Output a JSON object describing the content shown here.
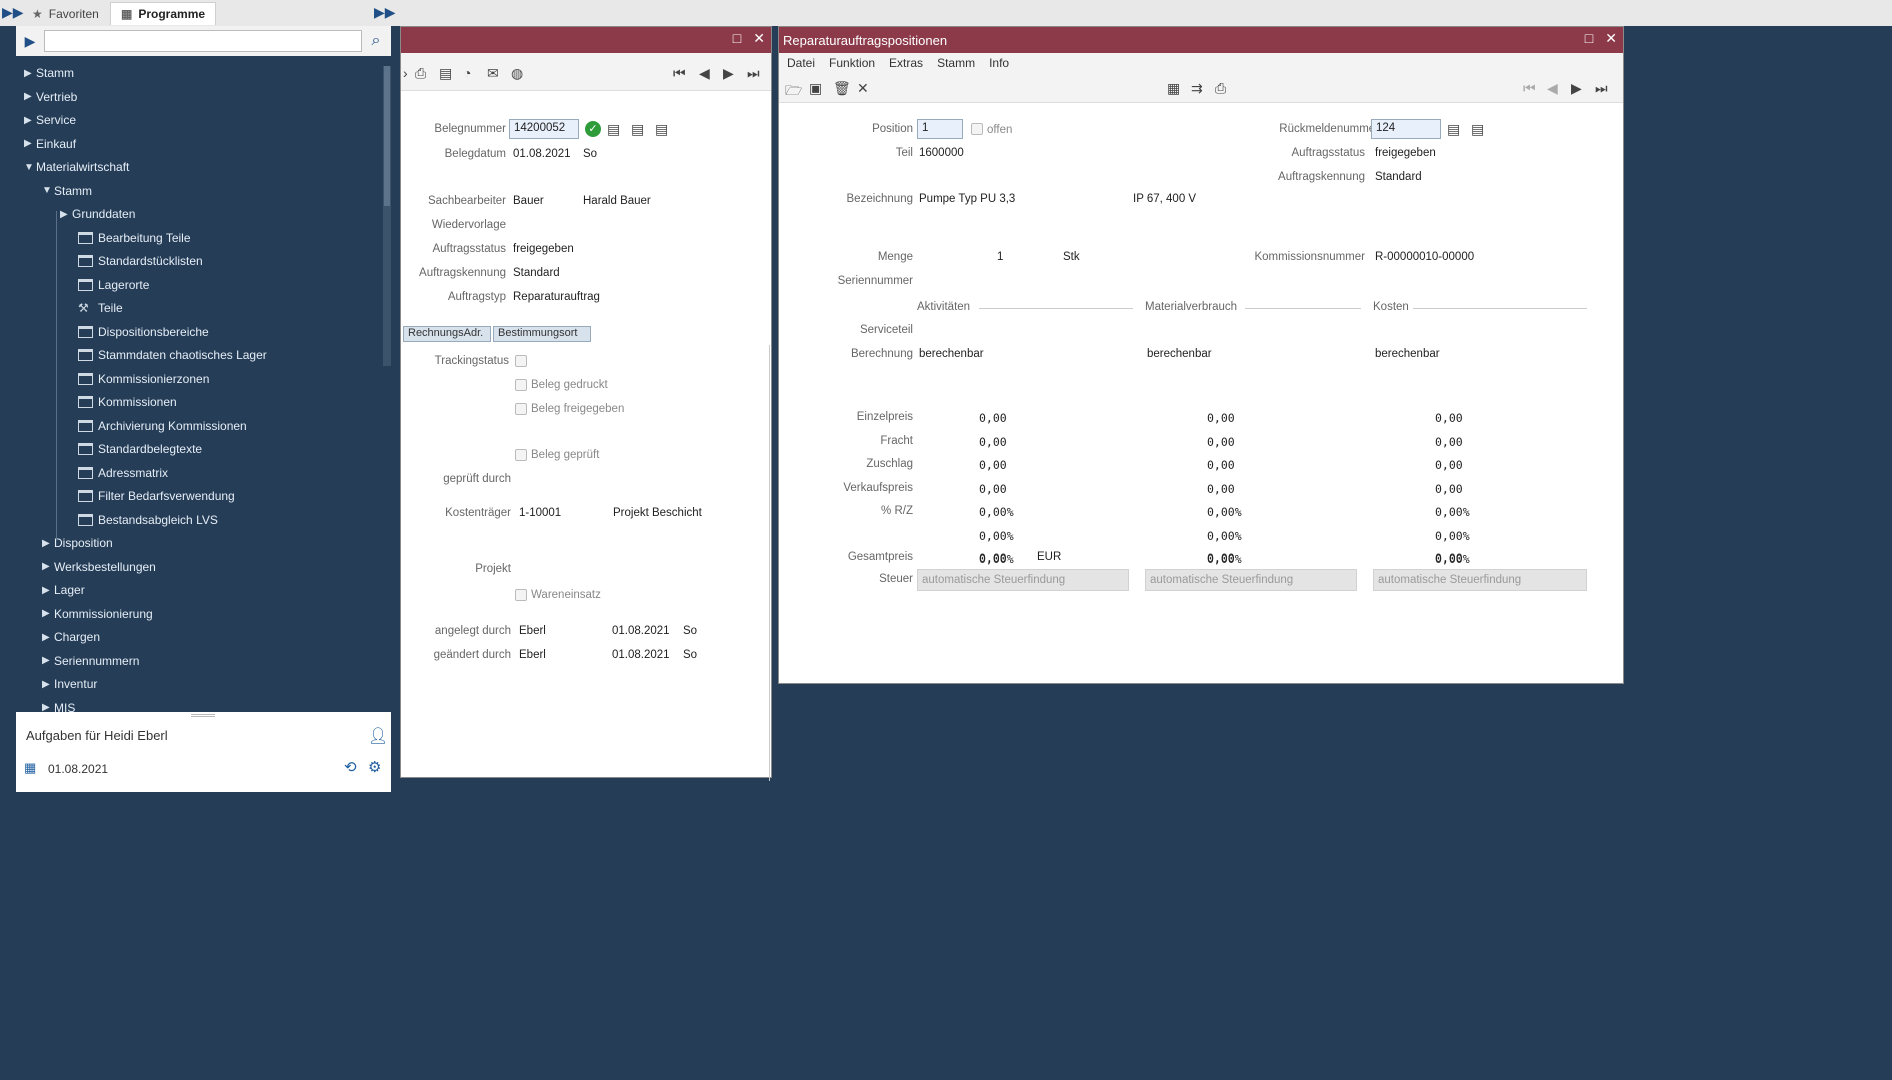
{
  "topbar": {
    "tabs": [
      {
        "label": "Favoriten",
        "icon": "star-icon"
      },
      {
        "label": "Programme",
        "icon": "programs-icon"
      }
    ]
  },
  "nav": {
    "search_placeholder": "",
    "tree": [
      {
        "label": "Stamm",
        "level": 0,
        "type": "folder",
        "expanded": false
      },
      {
        "label": "Vertrieb",
        "level": 0,
        "type": "folder",
        "expanded": false
      },
      {
        "label": "Service",
        "level": 0,
        "type": "folder",
        "expanded": false
      },
      {
        "label": "Einkauf",
        "level": 0,
        "type": "folder",
        "expanded": false
      },
      {
        "label": "Materialwirtschaft",
        "level": 0,
        "type": "folder",
        "expanded": true
      },
      {
        "label": "Stamm",
        "level": 1,
        "type": "folder",
        "expanded": true
      },
      {
        "label": "Grunddaten",
        "level": 2,
        "type": "folder",
        "expanded": false
      },
      {
        "label": "Bearbeitung Teile",
        "level": 3,
        "type": "page"
      },
      {
        "label": "Standardstücklisten",
        "level": 3,
        "type": "page"
      },
      {
        "label": "Lagerorte",
        "level": 3,
        "type": "page"
      },
      {
        "label": "Teile",
        "level": 3,
        "type": "tool"
      },
      {
        "label": "Dispositionsbereiche",
        "level": 3,
        "type": "page"
      },
      {
        "label": "Stammdaten chaotisches Lager",
        "level": 3,
        "type": "page"
      },
      {
        "label": "Kommissionierzonen",
        "level": 3,
        "type": "page"
      },
      {
        "label": "Kommissionen",
        "level": 3,
        "type": "page"
      },
      {
        "label": "Archivierung Kommissionen",
        "level": 3,
        "type": "page"
      },
      {
        "label": "Standardbelegtexte",
        "level": 3,
        "type": "page"
      },
      {
        "label": "Adressmatrix",
        "level": 3,
        "type": "page"
      },
      {
        "label": "Filter Bedarfsverwendung",
        "level": 3,
        "type": "page"
      },
      {
        "label": "Bestandsabgleich LVS",
        "level": 3,
        "type": "page"
      },
      {
        "label": "Disposition",
        "level": 1,
        "type": "folder",
        "expanded": false
      },
      {
        "label": "Werksbestellungen",
        "level": 1,
        "type": "folder",
        "expanded": false
      },
      {
        "label": "Lager",
        "level": 1,
        "type": "folder",
        "expanded": false
      },
      {
        "label": "Kommissionierung",
        "level": 1,
        "type": "folder",
        "expanded": false
      },
      {
        "label": "Chargen",
        "level": 1,
        "type": "folder",
        "expanded": false
      },
      {
        "label": "Seriennummern",
        "level": 1,
        "type": "folder",
        "expanded": false
      },
      {
        "label": "Inventur",
        "level": 1,
        "type": "folder",
        "expanded": false
      },
      {
        "label": "MIS",
        "level": 1,
        "type": "folder",
        "expanded": false
      }
    ]
  },
  "tasks": {
    "title": "Aufgaben für Heidi Eberl",
    "date": "01.08.2021"
  },
  "auftrag": {
    "belegnummer_label": "Belegnummer",
    "belegnummer": "14200052",
    "belegdatum_label": "Belegdatum",
    "belegdatum": "01.08.2021",
    "belegdatum_day": "So",
    "sachbearbeiter_label": "Sachbearbeiter",
    "sachbearbeiter_code": "Bauer",
    "sachbearbeiter_name": "Harald Bauer",
    "wiedervorlage_label": "Wiedervorlage",
    "auftragsstatus_label": "Auftragsstatus",
    "auftragsstatus": "freigegeben",
    "auftragskennung_label": "Auftragskennung",
    "auftragskennung": "Standard",
    "auftragstyp_label": "Auftragstyp",
    "auftragstyp": "Reparaturauftrag",
    "subtabs": [
      "RechnungsAdr.",
      "Bestimmungsort"
    ],
    "trackingstatus_label": "Trackingstatus",
    "beleg_gedruckt": "Beleg gedruckt",
    "beleg_freigegeben": "Beleg freigegeben",
    "beleg_geprueft": "Beleg geprüft",
    "geprueft_durch_label": "geprüft durch",
    "kostentraeger_label": "Kostenträger",
    "kostentraeger": "1-10001",
    "kostentraeger_name": "Projekt Beschicht",
    "projekt_label": "Projekt",
    "wareneinsatz": "Wareneinsatz",
    "angelegt_label": "angelegt durch",
    "angelegt_user": "Eberl",
    "angelegt_date": "01.08.2021",
    "angelegt_day": "So",
    "geaendert_label": "geändert durch",
    "geaendert_user": "Eberl",
    "geaendert_date": "01.08.2021",
    "geaendert_day": "So"
  },
  "positionen": {
    "title": "Reparaturauftragspositionen",
    "menu": [
      "Datei",
      "Funktion",
      "Extras",
      "Stamm",
      "Info"
    ],
    "position_label": "Position",
    "position": "1",
    "offen": "offen",
    "rueckmelde_label": "Rückmeldenummer",
    "rueckmelde": "124",
    "teil_label": "Teil",
    "teil": "1600000",
    "auftragsstatus_label": "Auftragsstatus",
    "auftragsstatus": "freigegeben",
    "auftragskennung_label": "Auftragskennung",
    "auftragskennung": "Standard",
    "bezeichnung_label": "Bezeichnung",
    "bezeichnung": "Pumpe Typ PU 3,3",
    "bezeichnung2": "IP 67, 400 V",
    "menge_label": "Menge",
    "menge": "1",
    "einheit": "Stk",
    "kommission_label": "Kommissionsnummer",
    "kommission": "R-00000010-00000",
    "seriennummer_label": "Seriennummer",
    "columns": [
      "Aktivitäten",
      "Materialverbrauch",
      "Kosten"
    ],
    "serviceteil_label": "Serviceteil",
    "berechnung_label": "Berechnung",
    "berechnung": [
      "berechenbar",
      "berechenbar",
      "berechenbar"
    ],
    "price_rows": [
      {
        "label": "Einzelpreis",
        "values": [
          "0,00",
          "0,00",
          "0,00"
        ]
      },
      {
        "label": "Fracht",
        "values": [
          "0,00",
          "0,00",
          "0,00"
        ]
      },
      {
        "label": "Zuschlag",
        "values": [
          "0,00",
          "0,00",
          "0,00"
        ]
      },
      {
        "label": "Verkaufspreis",
        "values": [
          "0,00",
          "0,00",
          "0,00"
        ]
      },
      {
        "label": "% R/Z",
        "values": [
          "0,00%",
          "0,00%",
          "0,00%"
        ]
      },
      {
        "label": "",
        "values": [
          "0,00%",
          "0,00%",
          "0,00%"
        ]
      },
      {
        "label": "",
        "values": [
          "0,00%",
          "0,00%",
          "0,00%"
        ]
      }
    ],
    "gesamt_label": "Gesamtpreis",
    "gesamt": [
      "0,00",
      "0,00",
      "0,00"
    ],
    "currency": "EUR",
    "steuer_label": "Steuer",
    "steuer": [
      "automatische Steuerfindung",
      "automatische Steuerfindung",
      "automatische Steuerfindung"
    ]
  }
}
